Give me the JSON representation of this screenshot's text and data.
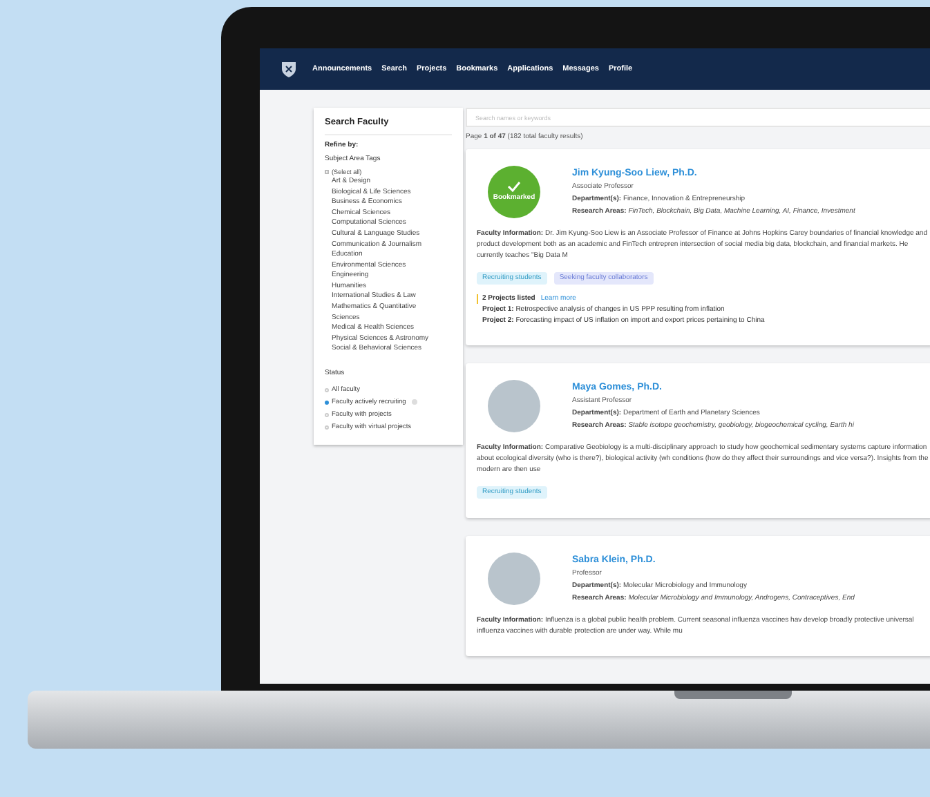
{
  "nav": {
    "items": [
      "Announcements",
      "Search",
      "Projects",
      "Bookmarks",
      "Applications",
      "Messages",
      "Profile"
    ]
  },
  "sidebar": {
    "title": "Search Faculty",
    "refine_label": "Refine by:",
    "tags_label": "Subject Area Tags",
    "select_all": {
      "label": "(Select all)",
      "checked": false
    },
    "tags": [
      "Art & Design",
      "Biological & Life Sciences",
      "Business & Economics",
      "Chemical Sciences",
      "Computational Sciences",
      "Cultural & Language Studies",
      "Communication & Journalism",
      "Education",
      "Environmental Sciences",
      "Engineering",
      "Humanities",
      "International Studies & Law",
      "Mathematics & Quantitative Sciences",
      "Medical & Health Sciences",
      "Physical Sciences & Astronomy",
      "Social & Behavioral Sciences"
    ],
    "status_label": "Status",
    "status_options": [
      {
        "label": "All faculty",
        "selected": false,
        "info": false
      },
      {
        "label": "Faculty actively recruiting",
        "selected": true,
        "info": true
      },
      {
        "label": "Faculty with projects",
        "selected": false,
        "info": false
      },
      {
        "label": "Faculty with virtual projects",
        "selected": false,
        "info": false
      }
    ]
  },
  "search": {
    "placeholder": "Search names or keywords"
  },
  "results_summary": "Page **1 of 47** (182 total faculty results)",
  "cards": [
    {
      "avatar": {
        "kind": "badge",
        "label": "Bookmarked"
      },
      "name": "Jim Kyung-Soo Liew, Ph.D.",
      "title": "Associate Professor",
      "department_label": "Department(s):",
      "department": "Finance, Innovation & Entrepreneurship",
      "research_label": "Research Areas:",
      "research": "FinTech, Blockchain, Big Data, Machine Learning, AI, Finance, Investment",
      "info_label": "Faculty Information:",
      "info": "Dr. Jim Kyung-Soo Liew is an Associate Professor of Finance at Johns Hopkins Carey boundaries of financial knowledge and product development both as an academic and FinTech entrepren intersection of social media big data, blockchain, and financial markets. He currently teaches \"Big Data M",
      "tags": [
        {
          "label": "Recruiting students",
          "kind": "recruiting"
        },
        {
          "label": "Seeking faculty collaborators",
          "kind": "seeking"
        }
      ],
      "projects": {
        "count": "2 Projects listed",
        "link": "Learn more",
        "items": [
          {
            "label": "Project 1:",
            "text": "Retrospective analysis of changes in US PPP resulting from inflation"
          },
          {
            "label": "Project 2:",
            "text": "Forecasting impact of US inflation on import and export prices pertaining to China"
          }
        ]
      }
    },
    {
      "avatar": {
        "kind": "photo"
      },
      "name": "Maya Gomes, Ph.D.",
      "title": "Assistant Professor",
      "department_label": "Department(s):",
      "department": "Department of Earth and Planetary Sciences",
      "research_label": "Research Areas:",
      "research": "Stable isotope geochemistry, geobiology, biogeochemical cycling, Earth hi",
      "info_label": "Faculty Information:",
      "info": "Comparative Geobiology is a multi-disciplinary approach to study how geochemical sedimentary systems capture information about ecological diversity (who is there?), biological activity (wh conditions (how do they affect their surroundings and vice versa?). Insights from the modern are then use",
      "tags": [
        {
          "label": "Recruiting students",
          "kind": "recruiting"
        }
      ]
    },
    {
      "avatar": {
        "kind": "photo"
      },
      "name": "Sabra Klein, Ph.D.",
      "title": "Professor",
      "department_label": "Department(s):",
      "department": "Molecular Microbiology and Immunology",
      "research_label": "Research Areas:",
      "research": "Molecular Microbiology and Immunology, Androgens, Contraceptives, End",
      "info_label": "Faculty Information:",
      "info": "Influenza is a global public health problem. Current seasonal influenza vaccines hav develop broadly protective universal influenza vaccines with durable protection are under way. While mu"
    }
  ]
}
